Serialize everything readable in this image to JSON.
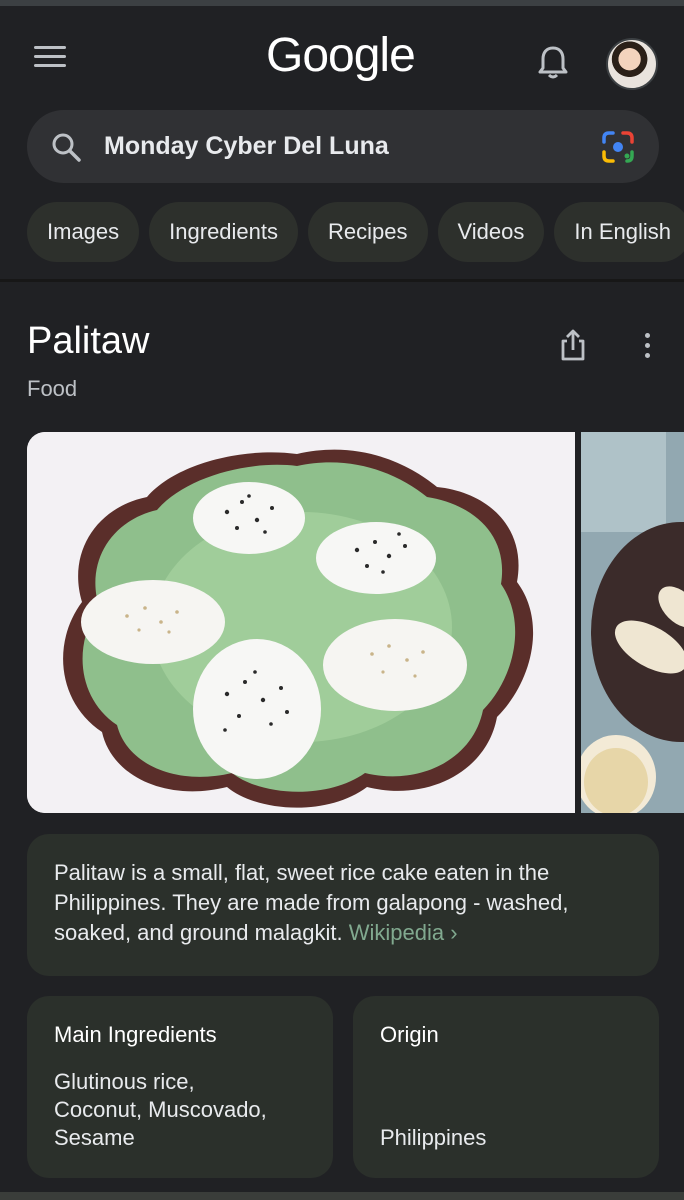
{
  "header": {
    "logo": "Google",
    "icons": [
      "menu-icon",
      "bell-icon",
      "avatar"
    ]
  },
  "search": {
    "query": "Monday Cyber Del Luna",
    "icons": [
      "search-icon",
      "lens-icon"
    ]
  },
  "chips": [
    {
      "label": "Images"
    },
    {
      "label": "Ingredients"
    },
    {
      "label": "Recipes"
    },
    {
      "label": "Videos"
    },
    {
      "label": "In English"
    }
  ],
  "knowledge_panel": {
    "title": "Palitaw",
    "subtitle": "Food",
    "description": "Palitaw is a small, flat, sweet rice cake eaten in the Philippines. They are made from galapong - washed, soaked, and ground malagkit.",
    "source_link": "Wikipedia",
    "source_chevron": "›",
    "facts": {
      "ingredients_label": "Main Ingredients",
      "ingredients_value": "Glutinous rice,\nCoconut, Muscovado,\nSesame",
      "origin_label": "Origin",
      "origin_value": "Philippines"
    }
  },
  "colors": {
    "background": "#202124",
    "card": "#2b302b",
    "chip": "#2d302c",
    "link": "#81a98f"
  }
}
